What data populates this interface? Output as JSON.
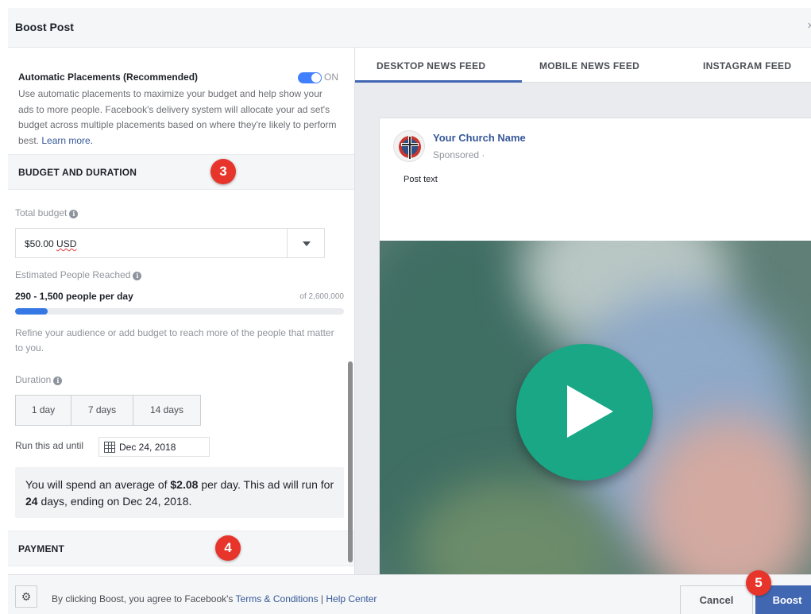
{
  "header": {
    "title": "Boost Post"
  },
  "placements": {
    "title": "Automatic Placements (Recommended)",
    "toggle_label": "ON",
    "description": "Use automatic placements to maximize your budget and help show your ads to more people. Facebook's delivery system will allocate your ad set's budget across multiple placements based on where they're likely to perform best. ",
    "learn_more": "Learn more."
  },
  "budget_section": {
    "title": "BUDGET AND DURATION",
    "badge": "3",
    "total_budget_label": "Total budget",
    "budget_amount": "$50.00",
    "budget_currency": "USD",
    "reach_label": "Estimated People Reached",
    "reach_value": "290 - 1,500 people per day",
    "reach_of": "of 2,600,000",
    "reach_fraction": 0.1,
    "refine_text": "Refine your audience or add budget to reach more of the people that matter to you.",
    "duration_label": "Duration",
    "durations": [
      "1 day",
      "7 days",
      "14 days"
    ],
    "run_until_label": "Run this ad until",
    "run_until_date": "Dec 24, 2018",
    "spend": {
      "prefix": "You will spend an average of ",
      "amount": "$2.08",
      "middle": " per day. This ad will run for ",
      "days": "24",
      "suffix": " days, ending on Dec 24, 2018."
    }
  },
  "payment_section": {
    "title": "PAYMENT",
    "badge": "4"
  },
  "preview": {
    "tabs": [
      "DESKTOP NEWS FEED",
      "MOBILE NEWS FEED",
      "INSTAGRAM FEED"
    ],
    "active_tab": 0,
    "page_name": "Your Church Name",
    "sponsored": "Sponsored ·",
    "post_text": "Post text"
  },
  "footer": {
    "prefix": "By clicking Boost, you agree to Facebook's ",
    "terms": "Terms & Conditions",
    "separator": " | ",
    "help": "Help Center",
    "cancel": "Cancel",
    "boost": "Boost",
    "badge": "5"
  },
  "colors": {
    "accent": "#4267b2",
    "toggle": "#4080ff",
    "link": "#365899",
    "badge": "#e7352b",
    "play": "#19a786"
  }
}
